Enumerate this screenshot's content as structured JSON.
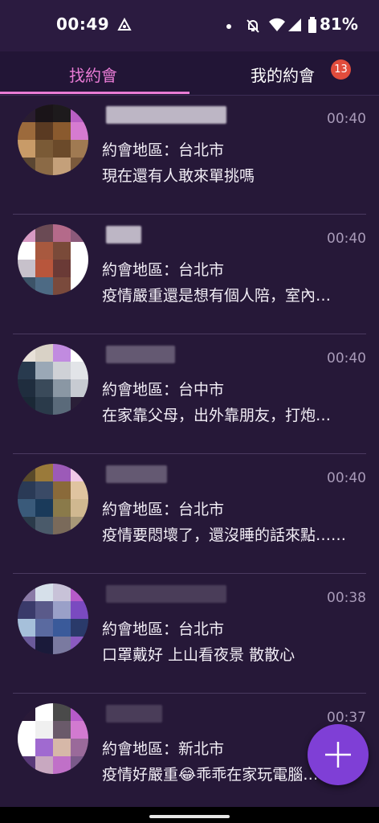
{
  "status_bar": {
    "time": "00:49",
    "battery": "81%"
  },
  "tabs": {
    "find_dates": "找約會",
    "my_dates": "我的約會",
    "my_dates_badge": "13",
    "active_color": "#e97bd5"
  },
  "posts": [
    {
      "time": "00:40",
      "area": "約會地區：台北市",
      "message": "現在還有人敢來單挑嗎",
      "avatar_colors": [
        "#2a1d30",
        "#1a1418",
        "#1d1a1c",
        "#b95fc4",
        "#9c6a3c",
        "#5a3a22",
        "#8a5a2e",
        "#d67bd0",
        "#c89b68",
        "#7a5a36",
        "#6b4a2a",
        "#a07a52",
        "#5b4632",
        "#8b6a46",
        "#c4a07a",
        "#7b5a3c"
      ]
    },
    {
      "time": "00:40",
      "area": "約會地區：台北市",
      "message": "疫情嚴重還是想有個人陪，室內…",
      "avatar_colors": [
        "#d79ac3",
        "#6a4a54",
        "#b46a8a",
        "#8c5a7a",
        "#ffffff",
        "#a8593f",
        "#7a4a39",
        "#ffffff",
        "#c7c1cb",
        "#b8563c",
        "#6a3a36",
        "#ffffff",
        "#3c5368",
        "#4d6a84",
        "#7a4a3c",
        "#ffffff"
      ]
    },
    {
      "time": "00:40",
      "area": "約會地區：台中市",
      "message": "在家靠父母，出外靠朋友，打炮…",
      "avatar_colors": [
        "#e8e1d8",
        "#d9d2c6",
        "#c18be0",
        "#ffffff",
        "#283a4e",
        "#9aa8b6",
        "#cfd1d6",
        "#e2e4e8",
        "#1f2d3e",
        "#3a4a5a",
        "#8a97a4",
        "#c7cbd2",
        "#1a2836",
        "#2a3a4a",
        "#5a6a7a",
        "#2a1f38"
      ]
    },
    {
      "time": "00:40",
      "area": "約會地區：台北市",
      "message": "疫情要悶壞了，還沒睡的話來點……",
      "avatar_colors": [
        "#5a4a2a",
        "#9a7a3a",
        "#9c5ab8",
        "#f0c8e8",
        "#2a3a56",
        "#3a4a66",
        "#8a6a3a",
        "#e0c4a0",
        "#3a5a7a",
        "#1a3a5a",
        "#8a7a4a",
        "#d0b890",
        "#2a3a4a",
        "#4a5a6a",
        "#7a6a5a",
        "#a89878"
      ]
    },
    {
      "time": "00:38",
      "area": "約會地區：台北市",
      "message": "口罩戴好 上山看夜景 散散心",
      "avatar_colors": [
        "#8a7aa6",
        "#d6e0ea",
        "#c8c2d8",
        "#b65ac9",
        "#3a3a6a",
        "#5a5a8a",
        "#9aa0c8",
        "#7a4ac0",
        "#a6c0da",
        "#5a6aa0",
        "#3a5a9a",
        "#2a3a6a",
        "#6a5a9a",
        "#1a1a3a",
        "#7a7aa0",
        "#8a5ac0"
      ]
    },
    {
      "time": "00:37",
      "area": "約會地區：新北市",
      "message": "疫情好嚴重😂乖乖在家玩電腦…",
      "avatar_colors": [
        "#2a1a38",
        "#ffffff",
        "#4a4a4a",
        "#b65ac9",
        "#ffffff",
        "#f0f0f0",
        "#6a5a6a",
        "#d27ad0",
        "#ffffff",
        "#a06ad0",
        "#d6b8a8",
        "#9a6a9a",
        "#5a3a7a",
        "#c8a8c0",
        "#c070c8",
        "#7a5a8a"
      ]
    }
  ]
}
